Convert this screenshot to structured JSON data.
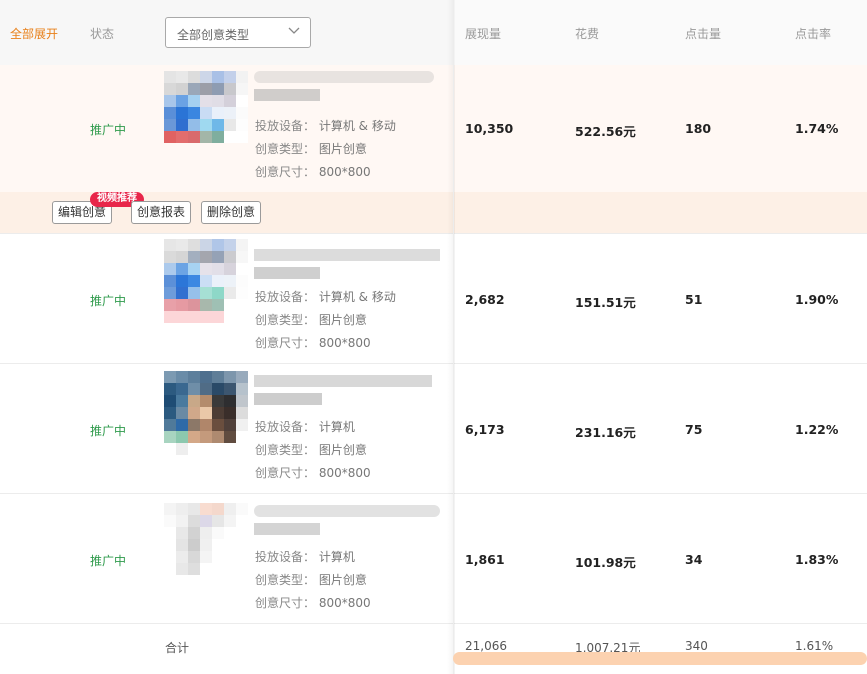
{
  "header": {
    "expand_all": "全部展开",
    "status": "状态",
    "type_select": "全部创意类型",
    "impressions": "展现量",
    "cost": "花费",
    "clicks": "点击量",
    "ctr": "点击率"
  },
  "labels": {
    "device": "投放设备：",
    "type": "创意类型：",
    "size": "创意尺寸："
  },
  "actions": {
    "edit": "编辑创意",
    "report": "创意报表",
    "delete": "删除创意",
    "badge": "视频推荐"
  },
  "rows": [
    {
      "status": "推广中",
      "device": "计算机 & 移动",
      "type": "图片创意",
      "size": "800*800",
      "impressions": "10,350",
      "cost": "522.56元",
      "clicks": "180",
      "ctr": "1.74%"
    },
    {
      "status": "推广中",
      "device": "计算机 & 移动",
      "type": "图片创意",
      "size": "800*800",
      "impressions": "2,682",
      "cost": "151.51元",
      "clicks": "51",
      "ctr": "1.90%"
    },
    {
      "status": "推广中",
      "device": "计算机",
      "type": "图片创意",
      "size": "800*800",
      "impressions": "6,173",
      "cost": "231.16元",
      "clicks": "75",
      "ctr": "1.22%"
    },
    {
      "status": "推广中",
      "device": "计算机",
      "type": "图片创意",
      "size": "800*800",
      "impressions": "1,861",
      "cost": "101.98元",
      "clicks": "34",
      "ctr": "1.83%"
    }
  ],
  "totals": {
    "label": "合计",
    "impressions": "21,066",
    "cost": "1,007.21元",
    "clicks": "340",
    "ctr": "1.61%"
  },
  "colors": {
    "accent_orange": "#e8801a",
    "status_green": "#2e9a4b",
    "badge_red": "#e8264a",
    "highlight_row": "#fff8f4",
    "scrollbar": "#fcd2b0"
  }
}
